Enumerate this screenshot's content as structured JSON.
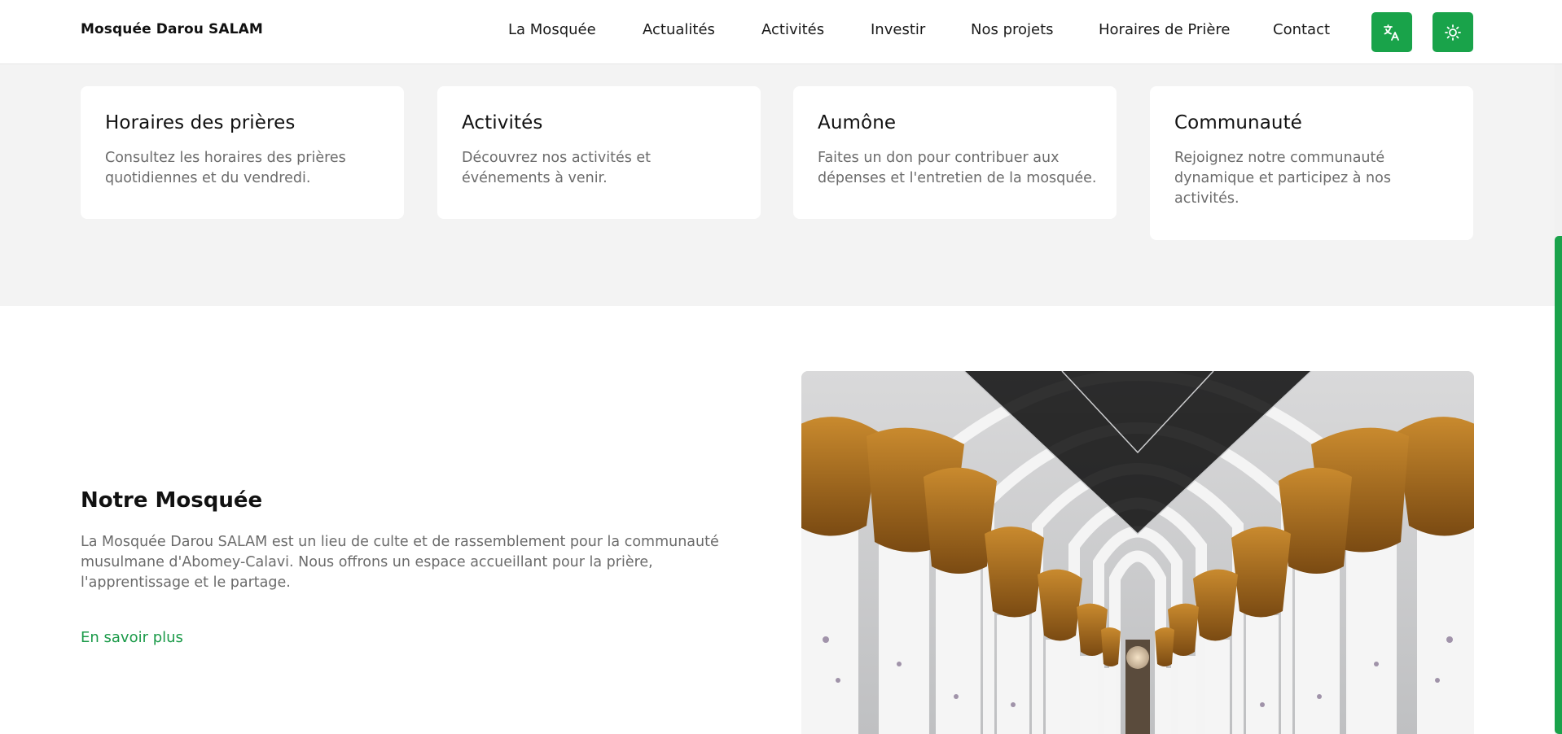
{
  "header": {
    "brand": "Mosquée Darou SALAM",
    "nav": [
      "La Mosquée",
      "Actualités",
      "Activités",
      "Investir",
      "Nos projets",
      "Horaires de Prière",
      "Contact"
    ],
    "translate_icon": "translate-icon",
    "theme_icon": "sun-icon",
    "accent_color": "#19a34a"
  },
  "features": [
    {
      "title": "Horaires des prières",
      "text": "Consultez les horaires des prières quotidiennes et du vendredi."
    },
    {
      "title": "Activités",
      "text": "Découvrez nos activités et événements à venir."
    },
    {
      "title": "Aumône",
      "text": "Faites un don pour contribuer aux dépenses et l'entretien de la mosquée."
    },
    {
      "title": "Communauté",
      "text": "Rejoignez notre communauté dynamique et participez à nos activités."
    }
  ],
  "about": {
    "title": "Notre Mosquée",
    "text": "La Mosquée Darou SALAM est un lieu de culte et de rassemblement pour la communauté musulmane d'Abomey-Calavi. Nous offrons un espace accueillant pour la prière, l'apprentissage et le partage.",
    "link": "En savoir plus"
  }
}
